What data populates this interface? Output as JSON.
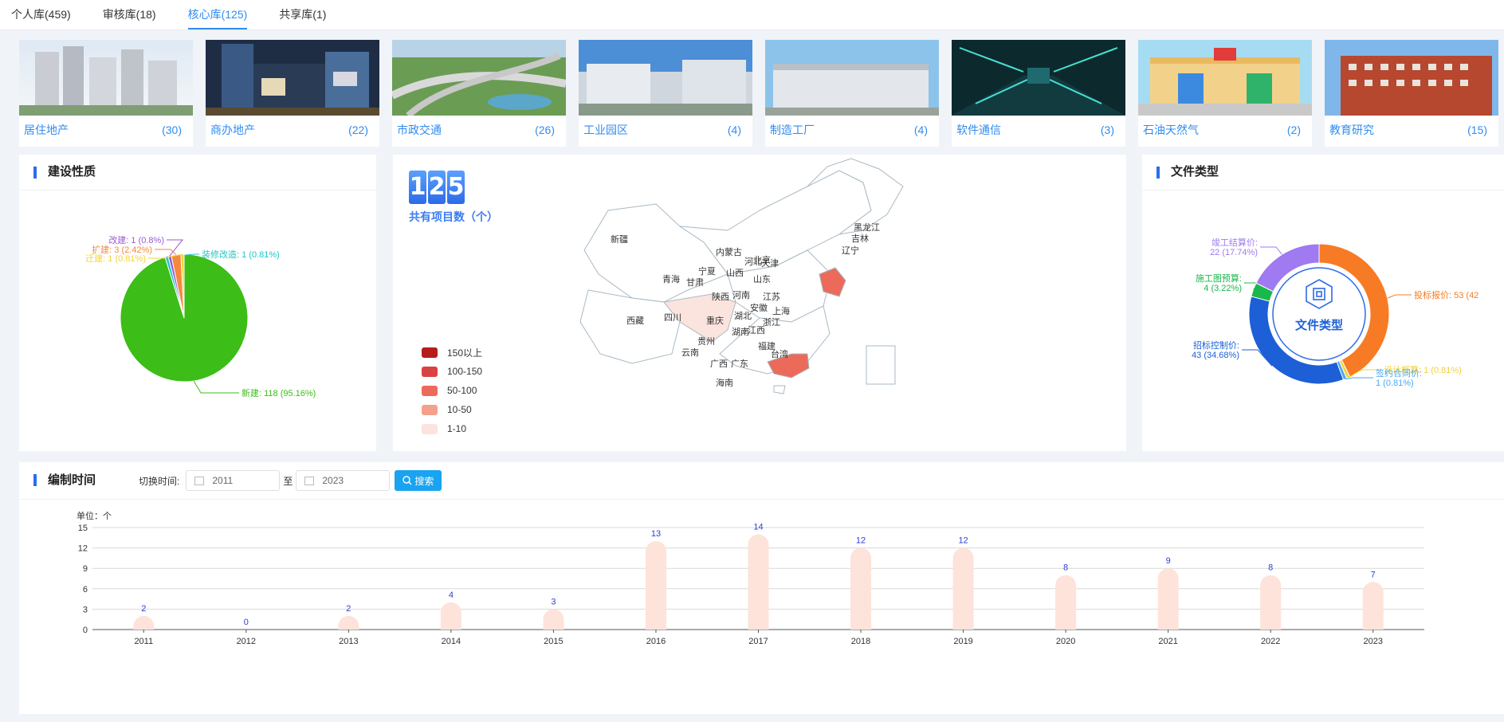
{
  "tabs": [
    {
      "label": "个人库(459)"
    },
    {
      "label": "审核库(18)"
    },
    {
      "label": "核心库(125)"
    },
    {
      "label": "共享库(1)"
    }
  ],
  "categories": [
    {
      "name": "居住地产",
      "count": "(30)"
    },
    {
      "name": "商办地产",
      "count": "(22)"
    },
    {
      "name": "市政交通",
      "count": "(26)"
    },
    {
      "name": "工业园区",
      "count": "(4)"
    },
    {
      "name": "制造工厂",
      "count": "(4)"
    },
    {
      "name": "软件通信",
      "count": "(3)"
    },
    {
      "name": "石油天然气",
      "count": "(2)"
    },
    {
      "name": "教育研究",
      "count": "(15)"
    }
  ],
  "panels": {
    "nature_title": "建设性质",
    "filetype_title": "文件类型",
    "time_title": "编制时间"
  },
  "map_panel": {
    "digits": [
      "1",
      "2",
      "5"
    ],
    "label": "共有项目数（个）",
    "legend": [
      {
        "label": "150以上",
        "color": "#b71c1c"
      },
      {
        "label": "100-150",
        "color": "#d84343"
      },
      {
        "label": "50-100",
        "color": "#ec6a5a"
      },
      {
        "label": "10-50",
        "color": "#f4a08c"
      },
      {
        "label": "1-10",
        "color": "#fbe4de"
      }
    ],
    "provinces": [
      "新疆",
      "西藏",
      "青海",
      "甘肃",
      "内蒙古",
      "黑龙江",
      "吉林",
      "辽宁",
      "宁夏",
      "山西",
      "河北",
      "北京",
      "天津",
      "山东",
      "陕西",
      "河南",
      "江苏",
      "四川",
      "重庆",
      "湖北",
      "安徽",
      "上海",
      "浙江",
      "湖南",
      "江西",
      "贵州",
      "云南",
      "福建",
      "台湾",
      "广西",
      "广东",
      "海南"
    ]
  },
  "filter": {
    "label": "切换时间:",
    "start": "2011",
    "separator": "至",
    "end": "2023",
    "button": "搜索"
  },
  "chart_data": [
    {
      "type": "pie",
      "title": "建设性质",
      "slices": [
        {
          "name": "新建",
          "value": 118,
          "label": "新建: 118 (95.16%)",
          "color": "#3cbd17"
        },
        {
          "name": "装修改造",
          "value": 1,
          "label": "装修改造: 1 (0.81%)",
          "color": "#1fc7c7"
        },
        {
          "name": "改建",
          "value": 1,
          "label": "改建: 1 (0.8%)",
          "color": "#9b59d0"
        },
        {
          "name": "扩建",
          "value": 3,
          "label": "扩建: 3 (2.42%)",
          "color": "#f5883c"
        },
        {
          "name": "迁建",
          "value": 1,
          "label": "迁建: 1 (0.81%)",
          "color": "#f3d33a"
        }
      ]
    },
    {
      "type": "pie",
      "title": "文件类型",
      "center_label": "文件类型",
      "slices": [
        {
          "name": "投标报价",
          "value": 53,
          "label": "投标报价: 53 (42",
          "color": "#f77b24"
        },
        {
          "name": "设计概算",
          "value": 1,
          "label": "设计概算: 1 (0.81%)",
          "color": "#f5d23a"
        },
        {
          "name": "签约合同价",
          "value": 1,
          "label": "签约合同价:\n1 (0.81%)",
          "color": "#4aa8f0"
        },
        {
          "name": "招标控制价",
          "value": 43,
          "label": "招标控制价:\n43 (34.68%)",
          "color": "#1c5fd6"
        },
        {
          "name": "施工图预算",
          "value": 4,
          "label": "施工图预算:\n4 (3.22%)",
          "color": "#19b84a"
        },
        {
          "name": "竣工结算价",
          "value": 22,
          "label": "竣工结算价:\n22 (17.74%)",
          "color": "#9f7af0"
        }
      ]
    },
    {
      "type": "bar",
      "title": "编制时间",
      "ylabel": "单位：个",
      "ylim": [
        0,
        15
      ],
      "yticks": [
        0,
        3,
        6,
        9,
        12,
        15
      ],
      "categories": [
        "2011",
        "2012",
        "2013",
        "2014",
        "2015",
        "2016",
        "2017",
        "2018",
        "2019",
        "2020",
        "2021",
        "2022",
        "2023"
      ],
      "values": [
        2,
        0,
        2,
        4,
        3,
        13,
        14,
        12,
        12,
        8,
        9,
        8,
        7
      ],
      "bar_color": "#fde3da",
      "label_color": "#2b3fd6",
      "grid": true
    }
  ]
}
